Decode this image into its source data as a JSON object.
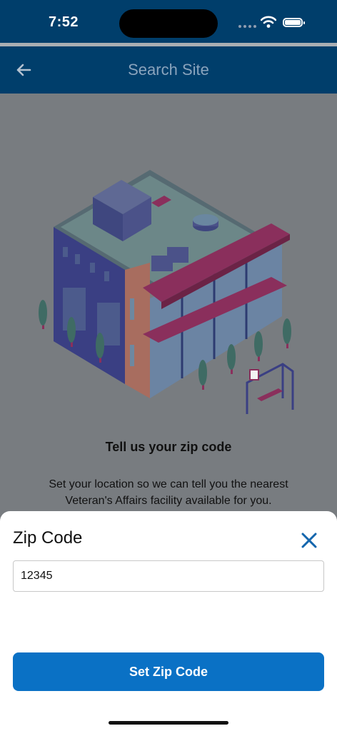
{
  "status_bar": {
    "time": "7:52",
    "icons": [
      "signal-icon",
      "wifi-icon",
      "battery-icon"
    ]
  },
  "header": {
    "title": "Search Site",
    "back_icon": "arrow-left-icon"
  },
  "illustration": {
    "subject": "building-illustration"
  },
  "main": {
    "heading": "Tell us your zip code",
    "description": "Set your location so we can tell you the nearest Veteran's Affairs facility available for you."
  },
  "sheet": {
    "title": "Zip Code",
    "close_icon": "close-icon",
    "zip_value": "12345",
    "submit_label": "Set Zip Code"
  },
  "colors": {
    "nav_bar": "#003e6b",
    "primary_button": "#0a71c5",
    "close_icon": "#1466ad",
    "overlay_background": "#787c80"
  }
}
